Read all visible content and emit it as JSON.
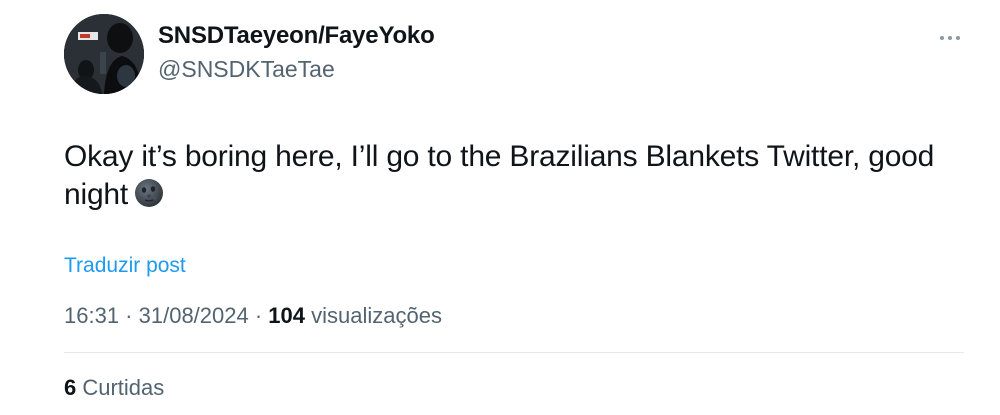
{
  "user": {
    "display_name": "SNSDTaeyeon/FayeYoko",
    "handle": "@SNSDKTaeTae"
  },
  "post": {
    "text": "Okay it’s boring here, I’ll go to the Brazilians Blankets Twitter, good night",
    "emoji": "new-moon-face",
    "translate_label": "Traduzir post"
  },
  "meta": {
    "time": "16:31",
    "sep1": " · ",
    "date": "31/08/2024",
    "sep2": " · ",
    "views_count": "104",
    "views_label": " visualizações"
  },
  "engagement": {
    "likes_count": "6",
    "likes_label": " Curtidas"
  },
  "icons": {
    "more": "more-horizontal-icon"
  },
  "colors": {
    "text": "#0f1419",
    "secondary": "#536471",
    "link": "#1d9bf0",
    "divider": "#e6e9ec"
  }
}
